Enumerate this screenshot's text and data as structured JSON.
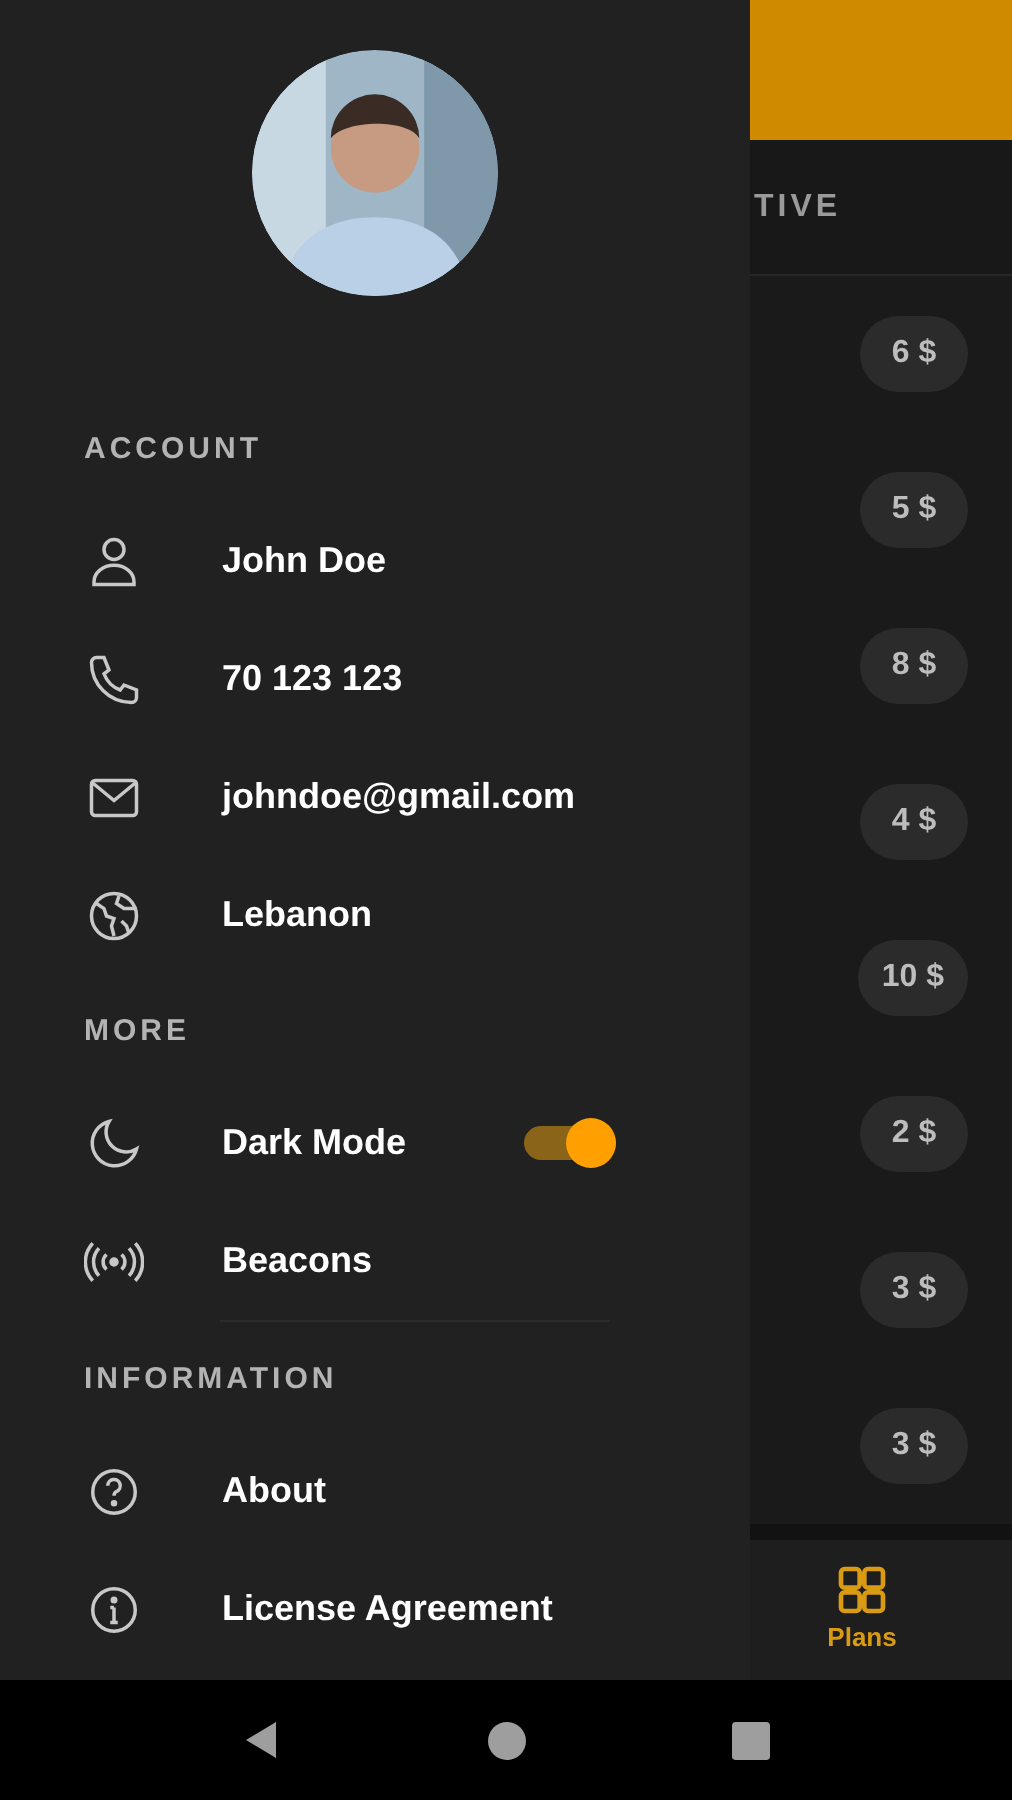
{
  "background": {
    "tab_label": "TIVE",
    "prices": [
      "6 $",
      "5 $",
      "8 $",
      "4 $",
      "10 $",
      "2 $",
      "3 $",
      "3 $"
    ],
    "bottom_nav": [
      {
        "label": "Plans",
        "selected": true
      }
    ]
  },
  "drawer": {
    "sections": [
      {
        "title": "ACCOUNT",
        "items": [
          {
            "kind": "link",
            "label": "John Doe"
          },
          {
            "kind": "link",
            "label": "70 123 123"
          },
          {
            "kind": "link",
            "label": "johndoe@gmail.com"
          },
          {
            "kind": "link",
            "label": "Lebanon"
          }
        ]
      },
      {
        "title": "MORE",
        "items": [
          {
            "kind": "toggle",
            "label": "Dark Mode",
            "on": true
          },
          {
            "kind": "link",
            "label": "Beacons"
          }
        ]
      },
      {
        "title": "INFORMATION",
        "items": [
          {
            "kind": "link",
            "label": "About"
          },
          {
            "kind": "link",
            "label": "License Agreement"
          }
        ]
      }
    ]
  }
}
